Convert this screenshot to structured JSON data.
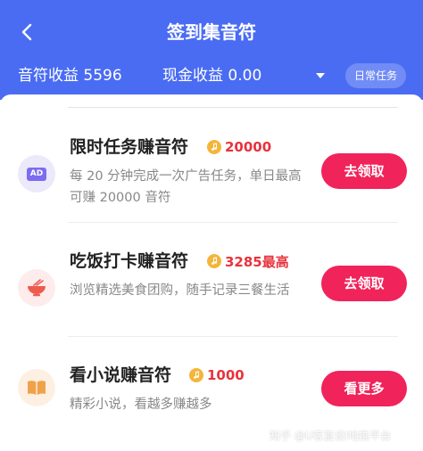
{
  "header": {
    "title": "签到集音符",
    "stats": {
      "notes_income": "音符收益 5596",
      "cash_income": "现金收益 0.00"
    },
    "daily_tasks_label": "日常任务"
  },
  "tasks": [
    {
      "icon_text": "AD",
      "title": "限时任务赚音符",
      "reward": "20000",
      "description": "每 20 分钟完成一次广告任务，单日最高可赚 20000 音符",
      "button": "去领取"
    },
    {
      "title": "吃饭打卡赚音符",
      "reward": "3285最高",
      "description": "浏览精选美食团购，随手记录三餐生活",
      "button": "去领取"
    },
    {
      "title": "看小说赚音符",
      "reward": "1000",
      "description": "精彩小说，看越多赚越多",
      "button": "看更多"
    }
  ],
  "watermark": "知乎 @U客直谈I地推平台",
  "colors": {
    "header_bg": "#4a6cf3",
    "accent_button": "#f0245a",
    "reward_text": "#e8323c",
    "coin": "#f4b53a"
  }
}
